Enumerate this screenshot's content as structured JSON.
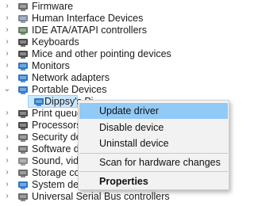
{
  "tree": {
    "items": [
      {
        "label": "Firmware",
        "chevron": "›",
        "icon": "firmware-icon",
        "color": "#6b6b6b"
      },
      {
        "label": "Human Interface Devices",
        "chevron": "›",
        "icon": "human-interface-devices-icon",
        "color": "#7a8a9a"
      },
      {
        "label": "IDE ATA/ATAPI controllers",
        "chevron": "›",
        "icon": "ide-controller-icon",
        "color": "#5f7f5f"
      },
      {
        "label": "Keyboards",
        "chevron": "›",
        "icon": "keyboard-icon",
        "color": "#4a4a4a"
      },
      {
        "label": "Mice and other pointing devices",
        "chevron": "›",
        "icon": "mouse-icon",
        "color": "#4a4a4a"
      },
      {
        "label": "Monitors",
        "chevron": "›",
        "icon": "monitor-icon",
        "color": "#2f78c4"
      },
      {
        "label": "Network adapters",
        "chevron": "›",
        "icon": "network-adapter-icon",
        "color": "#2f78c4"
      },
      {
        "label": "Portable Devices",
        "chevron": "⌄",
        "icon": "portable-devices-icon",
        "color": "#2f78c4"
      },
      {
        "label": "Dippsy's Pi",
        "chevron": "",
        "icon": "portable-device-icon",
        "color": "#2f78c4"
      },
      {
        "label": "Print queues",
        "chevron": "›",
        "icon": "printer-icon",
        "color": "#4a4a4a"
      },
      {
        "label": "Processors",
        "chevron": "›",
        "icon": "processor-icon",
        "color": "#4a4a4a"
      },
      {
        "label": "Security dev",
        "chevron": "›",
        "icon": "security-device-icon",
        "color": "#6b6b6b"
      },
      {
        "label": "Software dev",
        "chevron": "›",
        "icon": "software-device-icon",
        "color": "#6b6b6b"
      },
      {
        "label": "Sound, video",
        "chevron": "›",
        "icon": "sound-video-icon",
        "color": "#8a8a8a"
      },
      {
        "label": "Storage cont",
        "chevron": "›",
        "icon": "storage-controller-icon",
        "color": "#6b6b6b"
      },
      {
        "label": "System devices",
        "chevron": "›",
        "icon": "system-devices-icon",
        "color": "#2f78c4"
      },
      {
        "label": "Universal Serial Bus controllers",
        "chevron": "›",
        "icon": "usb-controller-icon",
        "color": "#6b6b6b"
      }
    ]
  },
  "context_menu": {
    "items": [
      {
        "label": "Update driver",
        "highlighted": true,
        "bold": false
      },
      {
        "label": "Disable device",
        "highlighted": false,
        "bold": false
      },
      {
        "label": "Uninstall device",
        "highlighted": false,
        "bold": false
      },
      {
        "label": "Scan for hardware changes",
        "highlighted": false,
        "bold": false
      },
      {
        "label": "Properties",
        "highlighted": false,
        "bold": true
      }
    ]
  },
  "colors": {
    "selection_bg": "#cce8ff",
    "menu_highlight": "#91c9f7",
    "menu_bg": "#f2f2f2"
  }
}
